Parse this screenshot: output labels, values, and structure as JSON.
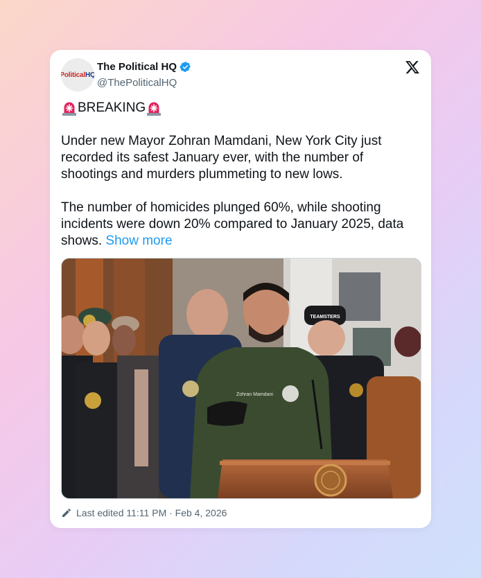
{
  "tweet": {
    "author": {
      "display_name": "The Political HQ",
      "handle": "@ThePoliticalHQ",
      "avatar_text_left": "Political",
      "avatar_text_right": "HQ",
      "verified": true
    },
    "headline": "BREAKING",
    "paragraph1": "Under new Mayor Zohran Mamdani, New York City just recorded its safest January ever, with the number of shootings and murders plummeting to new lows.",
    "paragraph2": "The number of homicides plunged 60%, while shooting incidents were down 20% compared to January 2025, data shows.",
    "show_more_label": "Show more",
    "image": {
      "jacket_name": "Zohran Mamdani",
      "cap_text": "TEAMSTERS"
    },
    "footer": {
      "edited_text": "Last edited 11:11 PM · Feb 4, 2026"
    }
  },
  "icons": {
    "close": "x-logo-icon",
    "verified": "verified-badge-icon",
    "siren": "rotating-light-icon",
    "edit": "pencil-icon"
  },
  "colors": {
    "link": "#1d9bf0",
    "verified": "#1d9bf0",
    "text": "#0f1419",
    "muted": "#536471"
  }
}
